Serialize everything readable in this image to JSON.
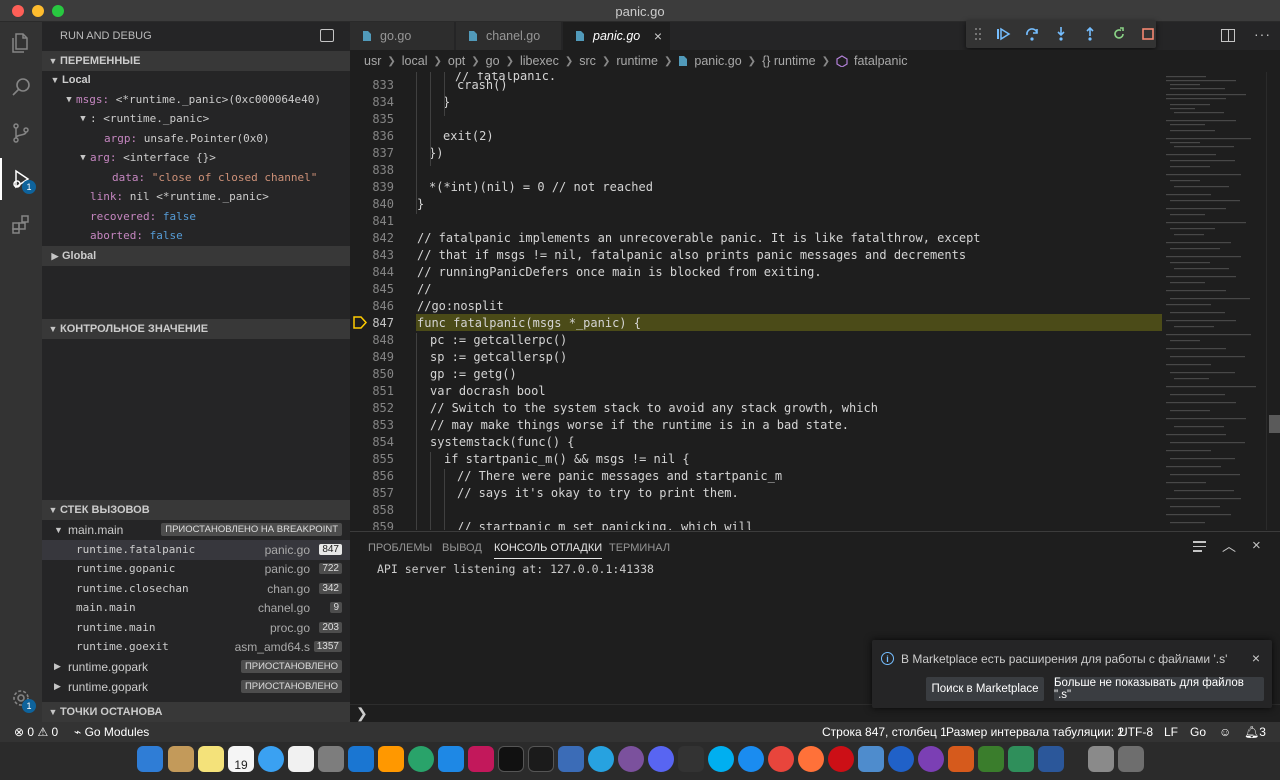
{
  "window": {
    "title": "panic.go"
  },
  "sidebar": {
    "title": "RUN AND DEBUG",
    "variables": {
      "header": "ПЕРЕМЕННЫЕ",
      "local_label": "Local",
      "global_label": "Global",
      "rows": [
        {
          "name": "msgs:",
          "value": "<*runtime._panic>(0xc000064e40)"
        },
        {
          "name": ":",
          "value": "<runtime._panic>"
        },
        {
          "name": "argp:",
          "value": "unsafe.Pointer(0x0)"
        },
        {
          "name": "arg:",
          "value": "<interface {}>"
        },
        {
          "name": "data:",
          "value": "\"close of closed channel\""
        },
        {
          "name": "link:",
          "value": "nil <*runtime._panic>"
        },
        {
          "name": "recovered:",
          "value": "false"
        },
        {
          "name": "aborted:",
          "value": "false"
        }
      ]
    },
    "watch": {
      "header": "КОНТРОЛЬНОЕ ЗНАЧЕНИЕ"
    },
    "callstack": {
      "header": "СТЕК ВЫЗОВОВ",
      "thread_main": "main.main",
      "thread_main_status": "ПРИОСТАНОВЛЕНО НА BREAKPOINT",
      "frames": [
        {
          "fn": "runtime.fatalpanic",
          "file": "panic.go",
          "line": "847"
        },
        {
          "fn": "runtime.gopanic",
          "file": "panic.go",
          "line": "722"
        },
        {
          "fn": "runtime.closechan",
          "file": "chan.go",
          "line": "342"
        },
        {
          "fn": "main.main",
          "file": "chanel.go",
          "line": "9"
        },
        {
          "fn": "runtime.main",
          "file": "proc.go",
          "line": "203"
        },
        {
          "fn": "runtime.goexit",
          "file": "asm_amd64.s",
          "line": "1357"
        }
      ],
      "other_threads": [
        {
          "name": "runtime.gopark",
          "status": "ПРИОСТАНОВЛЕНО"
        },
        {
          "name": "runtime.gopark",
          "status": "ПРИОСТАНОВЛЕНО"
        }
      ]
    },
    "breakpoints": {
      "header": "ТОЧКИ ОСТАНОВА"
    }
  },
  "tabs": [
    {
      "label": "go.go"
    },
    {
      "label": "chanel.go"
    },
    {
      "label": "panic.go"
    }
  ],
  "breadcrumb": [
    "usr",
    "local",
    "opt",
    "go",
    "libexec",
    "src",
    "runtime",
    "panic.go",
    "{} runtime",
    "fatalpanic"
  ],
  "editor": {
    "current_line": "847",
    "lines": [
      {
        "n": "833",
        "t": "crash()"
      },
      {
        "n": "834",
        "t": "}"
      },
      {
        "n": "835",
        "t": ""
      },
      {
        "n": "836",
        "t": "exit(2)"
      },
      {
        "n": "837",
        "t": "})"
      },
      {
        "n": "838",
        "t": ""
      },
      {
        "n": "839",
        "t": "*(*int)(nil) = 0 // not reached"
      },
      {
        "n": "840",
        "t": "}"
      },
      {
        "n": "841",
        "t": ""
      },
      {
        "n": "842",
        "t": "// fatalpanic implements an unrecoverable panic. It is like fatalthrow, except"
      },
      {
        "n": "843",
        "t": "// that if msgs != nil, fatalpanic also prints panic messages and decrements"
      },
      {
        "n": "844",
        "t": "// runningPanicDefers once main is blocked from exiting."
      },
      {
        "n": "845",
        "t": "//"
      },
      {
        "n": "846",
        "t": "//go:nosplit"
      },
      {
        "n": "847",
        "t": "func fatalpanic(msgs *_panic) {"
      },
      {
        "n": "848",
        "t": "pc := getcallerpc()"
      },
      {
        "n": "849",
        "t": "sp := getcallersp()"
      },
      {
        "n": "850",
        "t": "gp := getg()"
      },
      {
        "n": "851",
        "t": "var docrash bool"
      },
      {
        "n": "852",
        "t": "// Switch to the system stack to avoid any stack growth, which"
      },
      {
        "n": "853",
        "t": "// may make things worse if the runtime is in a bad state."
      },
      {
        "n": "854",
        "t": "systemstack(func() {"
      },
      {
        "n": "855",
        "t": "if startpanic_m() && msgs != nil {"
      },
      {
        "n": "856",
        "t": "// There were panic messages and startpanic_m"
      },
      {
        "n": "857",
        "t": "// says it's okay to try to print them."
      },
      {
        "n": "858",
        "t": ""
      },
      {
        "n": "859",
        "t": "// startpanic_m set panicking, which will"
      }
    ]
  },
  "panel": {
    "tabs": [
      "ПРОБЛЕМЫ",
      "ВЫВОД",
      "КОНСОЛЬ ОТЛАДКИ",
      "ТЕРМИНАЛ"
    ],
    "output": "API server listening at: 127.0.0.1:41338",
    "prompt": "❯"
  },
  "notification": {
    "message": "В Marketplace есть расширения для работы с файлами '.s'",
    "button_search": "Поиск в Marketplace",
    "button_dont_show": "Больше не показывать для файлов \".s\""
  },
  "statusbar": {
    "errors": "0",
    "warnings": "0",
    "go_modules": "Go Modules",
    "position": "Строка 847, столбец 1",
    "tab_size": "Размер интервала табуляции: 2",
    "encoding": "UTF-8",
    "eol": "LF",
    "language": "Go",
    "notifications": "3"
  },
  "dock": {
    "calendar_day": "19"
  },
  "colors": {
    "accent": "#0e639c",
    "highlight_line": "#4b4b18",
    "statusbar": "#333333"
  }
}
